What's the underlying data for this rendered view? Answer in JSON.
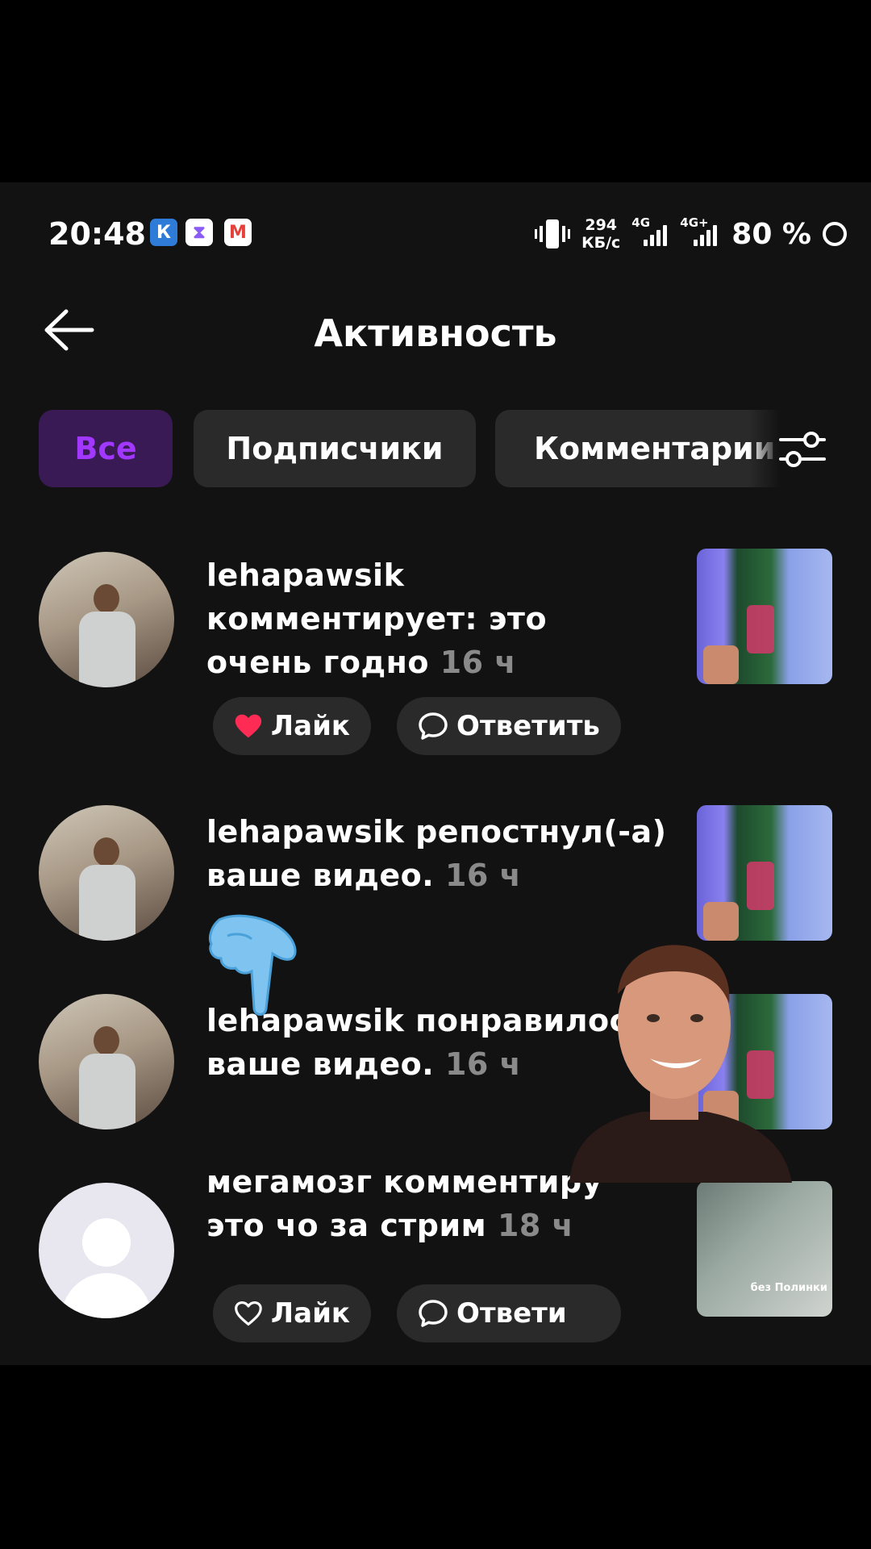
{
  "status_bar": {
    "time": "20:48",
    "app_icons": [
      {
        "name": "k-app-icon",
        "glyph": "К",
        "bg": "#2f7bd8"
      },
      {
        "name": "hourglass-app-icon",
        "glyph": "⧗",
        "bg": "#ffffff"
      },
      {
        "name": "gmail-icon",
        "glyph": "M",
        "bg": "#ffffff"
      }
    ],
    "net_speed_value": "294",
    "net_speed_unit": "КБ/с",
    "signal_1_label": "4G",
    "signal_2_label": "4G+",
    "battery": "80 %"
  },
  "header": {
    "title": "Активность",
    "back_icon": "arrow-left-icon"
  },
  "tabs": [
    {
      "label": "Все",
      "active": true
    },
    {
      "label": "Подписчики",
      "active": false
    },
    {
      "label": "Комментарии",
      "active": false
    }
  ],
  "filter_icon": "sliders-icon",
  "activity": [
    {
      "user": "lehapawsik",
      "line1_rest": "",
      "line2": "комментирует: это",
      "line3": "очень годно",
      "time": "16 ч",
      "actions": {
        "like": "Лайк",
        "reply": "Ответить"
      }
    },
    {
      "user": "lehapawsik",
      "line1_rest": "репостнул(-а)",
      "line2": "ваше видео.",
      "time": "16 ч"
    },
    {
      "user": "lehapawsik",
      "line1_rest": "понравилось",
      "line2": "ваше видео.",
      "time": "16 ч"
    },
    {
      "user": "мегамозг",
      "line1_rest": "комментиру",
      "line2": "это чо за стрим",
      "time": "18 ч",
      "thumb_caption": "без Полинки",
      "actions": {
        "like": "Лайк",
        "reply": "Ответи"
      }
    }
  ],
  "colors": {
    "background": "#121212",
    "tab_active_bg": "#3a1a55",
    "tab_active_text": "#a238ff",
    "pill_bg": "#2a2a2a",
    "like_heart": "#fe2c55",
    "muted": "#8a8a8a"
  }
}
